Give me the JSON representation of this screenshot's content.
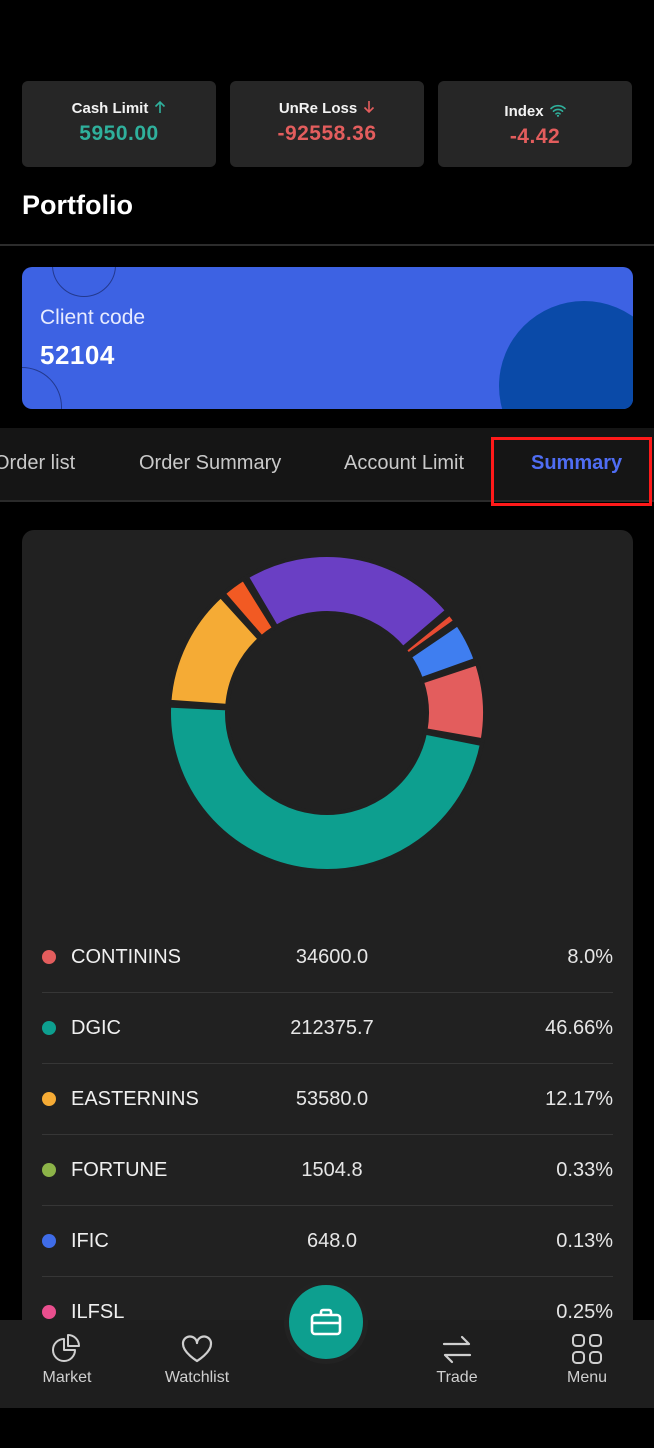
{
  "stats": {
    "cash": {
      "label": "Cash Limit",
      "value": "5950.00",
      "color": "#2fb09c"
    },
    "loss": {
      "label": "UnRe Loss",
      "value": "-92558.36",
      "color": "#e35d5d"
    },
    "index": {
      "label": "Index",
      "value": "-4.42",
      "color": "#e35d5d"
    }
  },
  "page": {
    "title": "Portfolio"
  },
  "client": {
    "label": "Client code",
    "code": "52104"
  },
  "tabs": [
    {
      "label": "Order list",
      "active": false
    },
    {
      "label": "Order Summary",
      "active": false
    },
    {
      "label": "Account Limit",
      "active": false
    },
    {
      "label": "Summary",
      "active": true
    }
  ],
  "chart_data": {
    "type": "pie",
    "variant": "donut",
    "series": [
      {
        "name": "CONTININS",
        "value": 34600.0,
        "percent": "8.0%",
        "color": "#e35d5d"
      },
      {
        "name": "DGIC",
        "value": 212375.7,
        "percent": "46.66%",
        "color": "#0d9f8f"
      },
      {
        "name": "EASTERNINS",
        "value": 53580.0,
        "percent": "12.17%",
        "color": "#f5ab35"
      },
      {
        "name": "FORTUNE",
        "value": 1504.8,
        "percent": "0.33%",
        "color": "#8cb348"
      },
      {
        "name": "IFIC",
        "value": 648.0,
        "percent": "0.13%",
        "color": "#3f6ce8"
      },
      {
        "name": "ILFSL",
        "value": null,
        "percent": "0.25%",
        "color": "#e94f8e"
      }
    ],
    "visible_slices": [
      {
        "color": "#e35d5d",
        "percent": 8.0
      },
      {
        "color": "#0d9f8f",
        "percent": 46.66
      },
      {
        "color": "#f5ab35",
        "percent": 12.17
      },
      {
        "color": "#f25a23",
        "percent": 2.8
      },
      {
        "color": "#6a3fc4",
        "percent": 22.0
      },
      {
        "color": "#e84b32",
        "percent": 1.3
      },
      {
        "color": "#3f7ef0",
        "percent": 4.3
      }
    ]
  },
  "legend": [
    {
      "name": "CONTININS",
      "amount": "34600.0",
      "percent": "8.0%",
      "color": "#e35d5d"
    },
    {
      "name": "DGIC",
      "amount": "212375.7",
      "percent": "46.66%",
      "color": "#0d9f8f"
    },
    {
      "name": "EASTERNINS",
      "amount": "53580.0",
      "percent": "12.17%",
      "color": "#f5ab35"
    },
    {
      "name": "FORTUNE",
      "amount": "1504.8",
      "percent": "0.33%",
      "color": "#8cb348"
    },
    {
      "name": "IFIC",
      "amount": "648.0",
      "percent": "0.13%",
      "color": "#3f6ce8"
    },
    {
      "name": "ILFSL",
      "amount": "",
      "percent": "0.25%",
      "color": "#e94f8e"
    }
  ],
  "nav": {
    "market": "Market",
    "watchlist": "Watchlist",
    "trade": "Trade",
    "menu": "Menu"
  },
  "icons": {
    "cash": "arrow-up-icon",
    "loss": "arrow-down-icon",
    "index": "wifi-icon",
    "market": "pie-chart-icon",
    "watchlist": "heart-icon",
    "fab": "briefcase-icon",
    "trade": "swap-arrows-icon",
    "menu": "grid-icon"
  }
}
